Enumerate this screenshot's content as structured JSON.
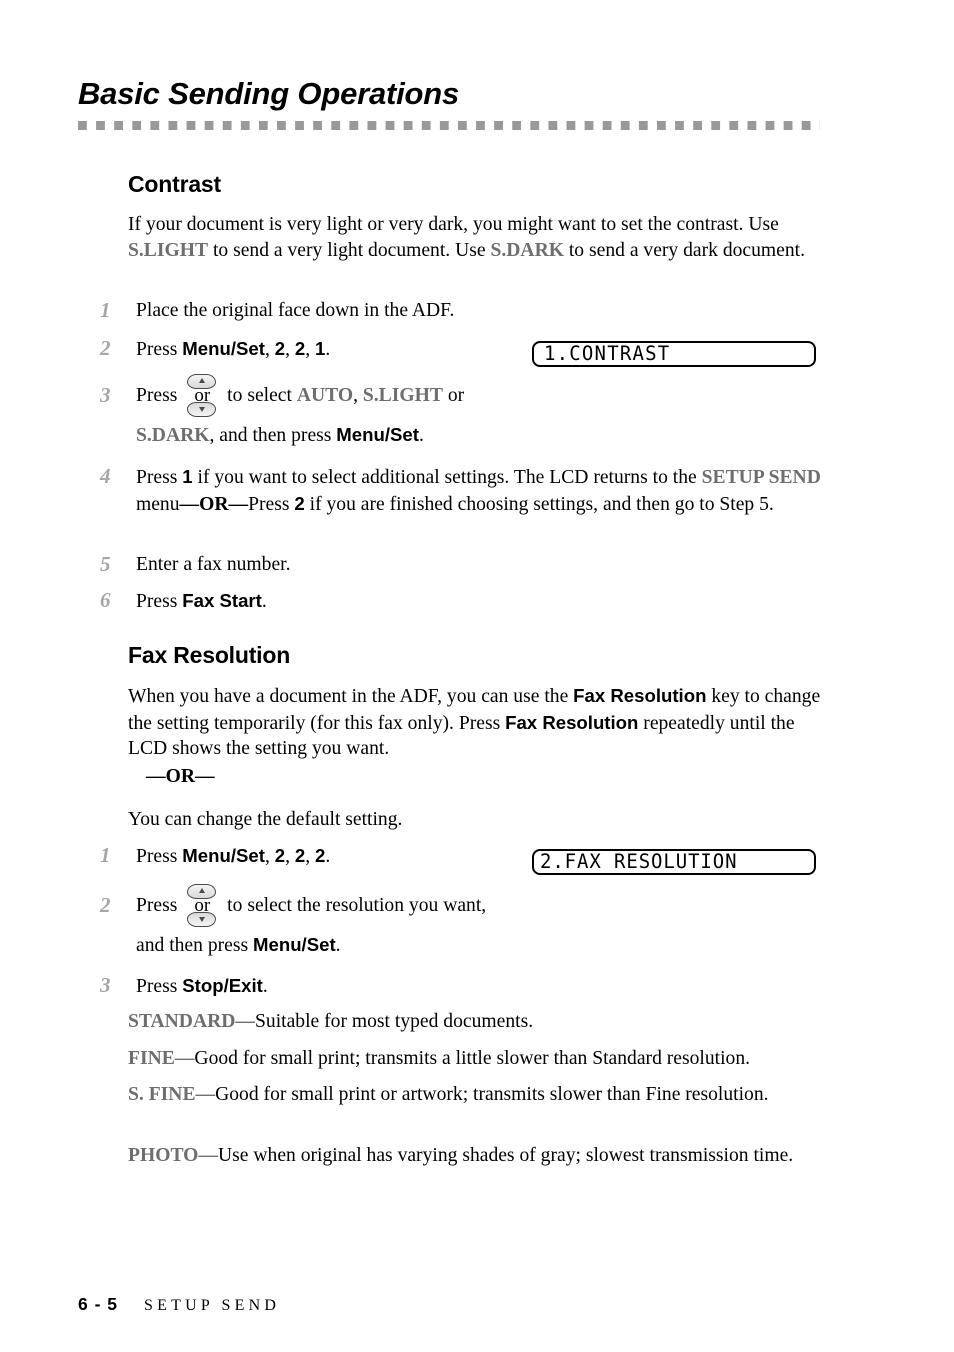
{
  "header": {
    "chapter_title": "Basic Sending Operations",
    "rule_color": "#999999"
  },
  "accent_color": "#6e6e6e",
  "step_number_color": "#a6a6a6",
  "sections": {
    "contrast": {
      "heading": "Contrast",
      "intro_part1": "If your document is very light or very dark, you might want to set the contrast. Use ",
      "intro_lcd1": "S.LIGHT",
      "intro_part2": " to send a very light document. Use ",
      "intro_lcd2": "S.DARK",
      "intro_part3": " to send a very dark document.",
      "steps": [
        {
          "num": "1",
          "text": "Place the original face down in the ADF."
        },
        {
          "num": "2",
          "press": "Press ",
          "key": "Menu/Set",
          "sep1": ", ",
          "n1": "2",
          "sep2": ", ",
          "n2": "2",
          "sep3": ", ",
          "n3": "1",
          "end": "."
        },
        {
          "num": "3",
          "press": "Press ",
          "icon": "up-down-key-icon",
          "mid": " to select ",
          "opt1": "AUTO",
          "comma1": ", ",
          "opt2": "S.LIGHT",
          "or": " or",
          "line2_opt3": "S.DARK",
          "line2_mid": ", and then press ",
          "line2_key": "Menu/Set",
          "line2_end": "."
        },
        {
          "num": "4",
          "t1": "Press ",
          "k1": "1",
          "t2": " if you want to select additional settings. The LCD returns to the ",
          "lcd": "SETUP SEND",
          "t3": " menu",
          "emdash1": "—",
          "or_bold": "OR",
          "emdash2": "—",
          "t4": "Press ",
          "k2": "2",
          "t5": " if you are finished choosing settings, and then go to Step 5."
        },
        {
          "num": "5",
          "text": "Enter a fax number."
        },
        {
          "num": "6",
          "press": "Press ",
          "key": "Fax Start",
          "end": "."
        }
      ],
      "lcd_display": "1.CONTRAST"
    },
    "fax_resolution": {
      "heading": "Fax Resolution",
      "intro_part1": "When you have a document in the ADF, you can use the ",
      "intro_key1": "Fax Resolution",
      "intro_part2": " key to change the setting temporarily (for this fax only). Press ",
      "intro_key2": "Fax Resolution",
      "intro_part3": " repeatedly until the LCD shows the setting you want.",
      "or_divider": "—OR—",
      "default_line": "You can change the default setting.",
      "steps": [
        {
          "num": "1",
          "press": "Press ",
          "key": "Menu/Set",
          "sep1": ", ",
          "n1": "2",
          "sep2": ", ",
          "n2": "2",
          "sep3": ", ",
          "n3": "2",
          "end": "."
        },
        {
          "num": "2",
          "press": "Press ",
          "icon": "up-down-key-icon",
          "mid": " to select the resolution you want,",
          "line2_pre": "and then press ",
          "line2_key": "Menu/Set",
          "line2_end": "."
        },
        {
          "num": "3",
          "press": "Press ",
          "key": "Stop/Exit",
          "end": "."
        }
      ],
      "lcd_display": "2.FAX RESOLUTION",
      "definitions": [
        {
          "term": "STANDARD",
          "dash": "—",
          "desc": "Suitable for most typed documents."
        },
        {
          "term": "FINE",
          "dash": "—",
          "desc": "Good for small print; transmits a little slower than Standard resolution."
        },
        {
          "term": "S. FINE",
          "dash": "—",
          "desc": "Good for small print or artwork; transmits slower than Fine resolution."
        },
        {
          "term": "PHOTO",
          "dash": "—",
          "desc": "Use when original has varying shades of gray; slowest transmission time."
        }
      ]
    }
  },
  "footer": {
    "page_number": "6 - 5",
    "running_head": "SETUP SEND"
  },
  "icons": {
    "up_down_key": {
      "or_label": "or"
    }
  }
}
